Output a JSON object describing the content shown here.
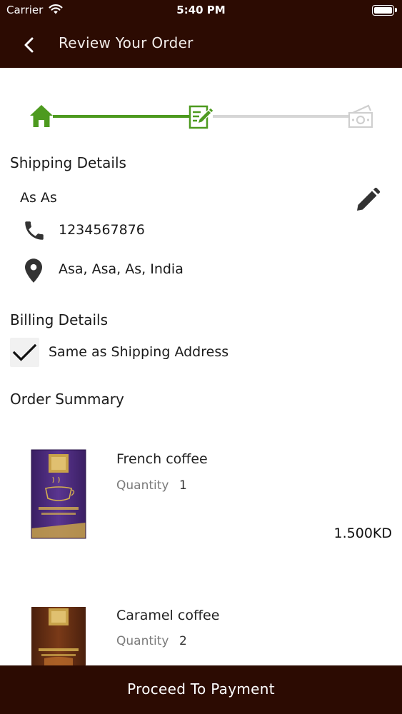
{
  "status_bar": {
    "carrier": "Carrier",
    "time": "5:40 PM",
    "wifi_icon": "wifi-icon",
    "battery_icon": "battery-icon"
  },
  "nav": {
    "title": "Review Your Order",
    "back_icon": "chevron-left-icon"
  },
  "stepper": {
    "steps": [
      {
        "icon": "home-icon",
        "state": "complete"
      },
      {
        "icon": "edit-document-icon",
        "state": "current"
      },
      {
        "icon": "payment-cash-icon",
        "state": "pending"
      }
    ],
    "colors": {
      "active": "#4d9a1f",
      "inactive": "#d6d6d6"
    }
  },
  "shipping": {
    "title": "Shipping Details",
    "name": "As As",
    "phone": "1234567876",
    "address": "Asa, Asa, As, India",
    "edit_icon": "pencil-icon",
    "phone_icon": "phone-icon",
    "location_icon": "location-pin-icon"
  },
  "billing": {
    "title": "Billing Details",
    "same_as_shipping_label": "Same as Shipping Address",
    "same_as_shipping_checked": true
  },
  "order_summary": {
    "title": "Order Summary",
    "quantity_label": "Quantity",
    "items": [
      {
        "name": "French coffee",
        "quantity": "1",
        "price": "1.500KD",
        "package_color": "#4a2a78"
      },
      {
        "name": "Caramel coffee",
        "quantity": "2",
        "price": "",
        "package_color": "#5a2a14"
      }
    ]
  },
  "footer": {
    "proceed_label": "Proceed To Payment"
  },
  "theme": {
    "brand_dark": "#2c0b02",
    "accent_green": "#4d9a1f"
  }
}
